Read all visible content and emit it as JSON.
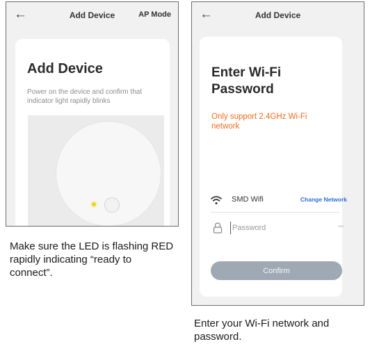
{
  "screen1": {
    "header": {
      "back_icon": "arrow-left-icon",
      "title": "Add Device",
      "ap_mode": "AP Mode"
    },
    "card": {
      "title": "Add Device",
      "description": "Power on the device and confirm that indicator light rapidly blinks"
    },
    "led_color": "#f0d21a",
    "caption": "Make sure the LED is flashing RED rapidly indicating “ready to connect”."
  },
  "screen2": {
    "header": {
      "back_icon": "arrow-left-icon",
      "title": "Add Device"
    },
    "card": {
      "title": "Enter Wi-Fi Password",
      "support_note": "Only support 2.4GHz Wi-Fi network",
      "support_note_color": "#f36a1e",
      "wifi": {
        "icon": "wifi-icon",
        "name": "SMD Wifi",
        "change_link": "Change Network"
      },
      "password": {
        "icon": "lock-icon",
        "placeholder": "Password",
        "value": ""
      },
      "confirm_label": "Confirm"
    },
    "caption": "Enter your Wi-Fi network and password."
  },
  "colors": {
    "link": "#2d6fd0",
    "button": "#9fa9b3",
    "card_bg": "#ffffff",
    "screen_bg": "#f1f1f1"
  }
}
